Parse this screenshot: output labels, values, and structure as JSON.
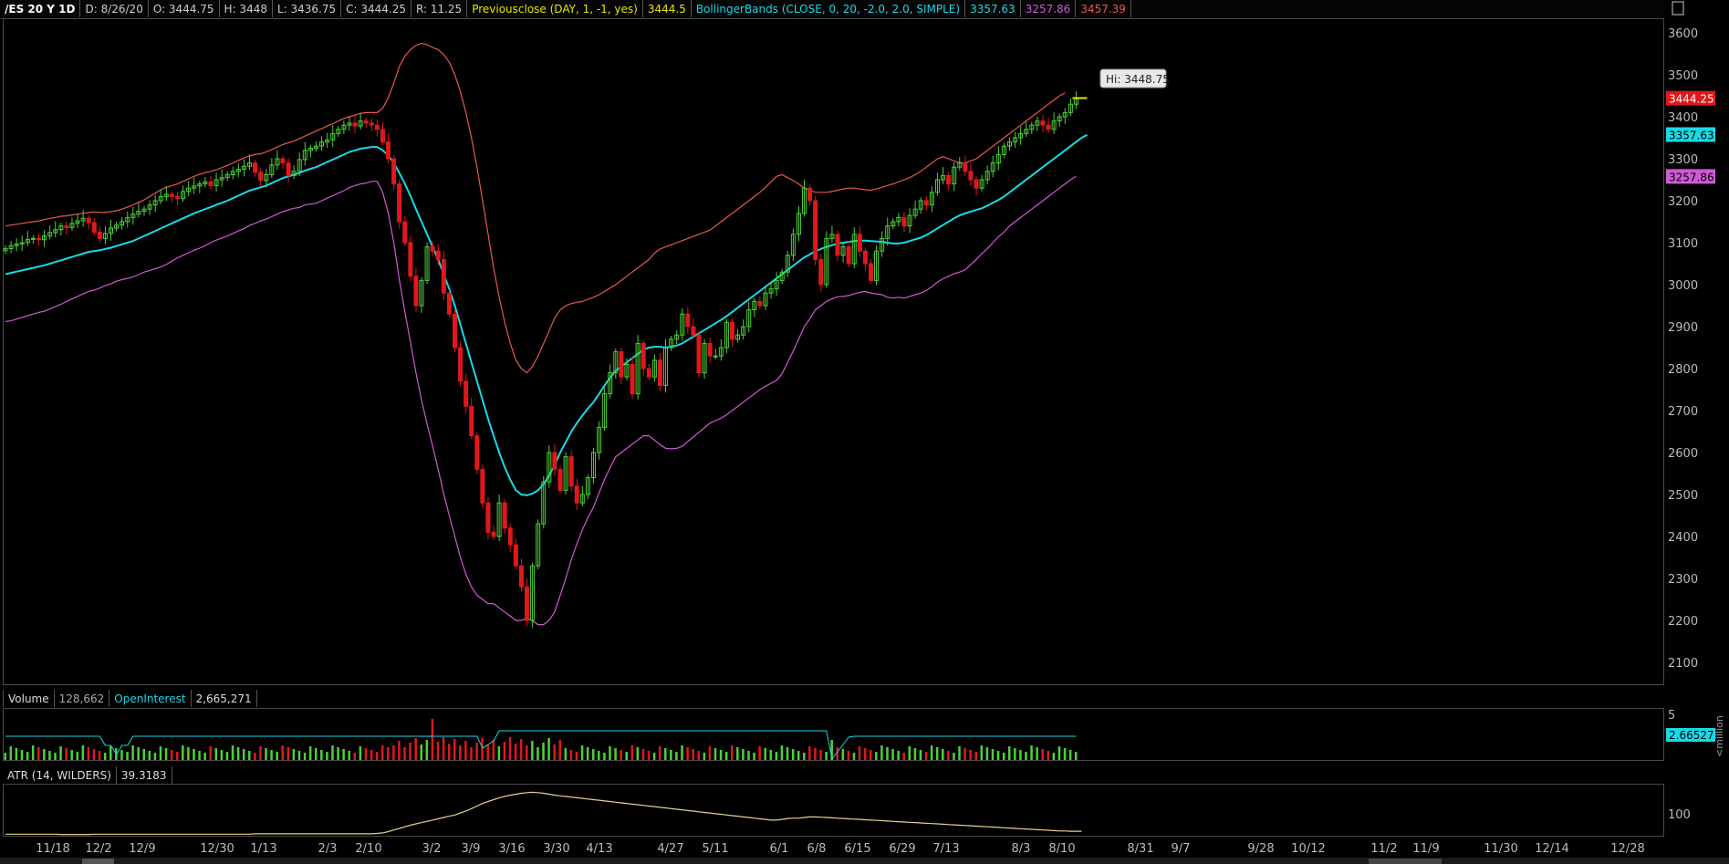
{
  "header": {
    "symbol": "/ES 20 Y 1D",
    "date": "D: 8/26/20",
    "open": "O: 3444.75",
    "high": "H: 3448",
    "low": "L: 3436.75",
    "close": "C: 3444.25",
    "range": "R: 11.25",
    "prev_close_label": "Previousclose (DAY, 1, -1, yes)",
    "prev_close_value": "3444.5",
    "bb_label": "BollingerBands (CLOSE, 0, 20, -2.0, 2.0, SIMPLE)",
    "bb_mid": "3357.63",
    "bb_lower": "3257.86",
    "bb_upper": "3457.39"
  },
  "volume_header": {
    "label": "Volume",
    "value": "128,662",
    "oi_label": "OpenInterest",
    "oi_value": "2,665,271"
  },
  "atr_header": {
    "label": "ATR (14, WILDERS)",
    "value": "39.3183"
  },
  "tooltip": "Hi: 3448.75",
  "right_tags": {
    "close": "3444.25",
    "mid": "3357.63",
    "lower": "3257.86",
    "oi": "2.66527",
    "vol_unit": "<million",
    "vol_tick": "5",
    "atr_tick": "100"
  },
  "colors": {
    "up": "#4cd137",
    "down": "#e0181b",
    "bb_upper": "#e8584e",
    "bb_mid": "#19d9e6",
    "bb_lower": "#d05ad6",
    "atr": "#e8cf8f",
    "oi": "#19d9e6",
    "prev_close": "#e6e600"
  },
  "chart_data": {
    "type": "line",
    "y_ticks": [
      2100,
      2200,
      2300,
      2400,
      2500,
      2600,
      2700,
      2800,
      2900,
      3000,
      3100,
      3200,
      3300,
      3400,
      3500,
      3600
    ],
    "ylim": [
      2060,
      3620
    ],
    "x_ticks": [
      "11/18",
      "12/2",
      "12/9",
      "12/30",
      "1/13",
      "2/3",
      "2/10",
      "3/2",
      "3/9",
      "3/16",
      "3/30",
      "4/13",
      "4/27",
      "5/11",
      "6/1",
      "6/8",
      "6/15",
      "6/29",
      "7/13",
      "8/3",
      "8/10",
      "8/31",
      "9/7",
      "9/28",
      "10/12",
      "11/2",
      "11/9",
      "11/30",
      "12/14",
      "12/28"
    ],
    "close": [
      3086,
      3093,
      3097,
      3100,
      3108,
      3110,
      3107,
      3116,
      3124,
      3131,
      3140,
      3136,
      3146,
      3152,
      3158,
      3148,
      3125,
      3110,
      3122,
      3135,
      3142,
      3150,
      3160,
      3168,
      3175,
      3180,
      3190,
      3200,
      3210,
      3215,
      3210,
      3205,
      3222,
      3230,
      3235,
      3240,
      3245,
      3236,
      3250,
      3255,
      3262,
      3270,
      3275,
      3282,
      3290,
      3268,
      3248,
      3262,
      3285,
      3300,
      3290,
      3260,
      3270,
      3298,
      3320,
      3325,
      3330,
      3340,
      3345,
      3360,
      3370,
      3380,
      3385,
      3378,
      3390,
      3385,
      3380,
      3370,
      3340,
      3300,
      3240,
      3150,
      3100,
      3020,
      2950,
      3010,
      3090,
      3080,
      3060,
      2980,
      2930,
      2850,
      2770,
      2710,
      2640,
      2560,
      2480,
      2410,
      2400,
      2480,
      2420,
      2380,
      2330,
      2280,
      2200,
      2330,
      2430,
      2530,
      2600,
      2560,
      2510,
      2590,
      2520,
      2480,
      2500,
      2540,
      2600,
      2660,
      2740,
      2790,
      2840,
      2780,
      2810,
      2740,
      2860,
      2800,
      2780,
      2820,
      2760,
      2850,
      2870,
      2880,
      2930,
      2900,
      2880,
      2790,
      2860,
      2830,
      2830,
      2850,
      2910,
      2870,
      2880,
      2900,
      2940,
      2960,
      2950,
      2980,
      2990,
      3010,
      3030,
      3070,
      3120,
      3170,
      3230,
      3200,
      3060,
      3000,
      3110,
      3120,
      3070,
      3090,
      3050,
      3120,
      3080,
      3050,
      3010,
      3080,
      3110,
      3140,
      3150,
      3160,
      3140,
      3165,
      3180,
      3200,
      3190,
      3220,
      3250,
      3260,
      3240,
      3280,
      3290,
      3270,
      3250,
      3230,
      3250,
      3270,
      3290,
      3310,
      3330,
      3340,
      3350,
      3360,
      3370,
      3380,
      3390,
      3380,
      3370,
      3390,
      3400,
      3410,
      3430,
      3444
    ],
    "bb_upper": [
      3140,
      3142,
      3144,
      3146,
      3148,
      3150,
      3152,
      3155,
      3158,
      3160,
      3163,
      3164,
      3166,
      3168,
      3170,
      3172,
      3173,
      3172,
      3172,
      3174,
      3176,
      3180,
      3185,
      3190,
      3196,
      3202,
      3210,
      3218,
      3226,
      3232,
      3236,
      3240,
      3246,
      3252,
      3258,
      3263,
      3267,
      3270,
      3274,
      3279,
      3284,
      3290,
      3296,
      3302,
      3307,
      3310,
      3312,
      3316,
      3322,
      3328,
      3334,
      3338,
      3342,
      3348,
      3354,
      3360,
      3366,
      3372,
      3378,
      3384,
      3390,
      3396,
      3400,
      3404,
      3408,
      3410,
      3410,
      3410,
      3420,
      3445,
      3480,
      3520,
      3545,
      3560,
      3570,
      3575,
      3572,
      3565,
      3560,
      3548,
      3530,
      3500,
      3460,
      3410,
      3350,
      3280,
      3200,
      3120,
      3040,
      2970,
      2910,
      2860,
      2820,
      2800,
      2790,
      2805,
      2830,
      2860,
      2890,
      2920,
      2940,
      2950,
      2955,
      2958,
      2960,
      2965,
      2970,
      2976,
      2984,
      2992,
      3000,
      3010,
      3020,
      3030,
      3040,
      3050,
      3060,
      3075,
      3085,
      3090,
      3095,
      3100,
      3105,
      3110,
      3115,
      3120,
      3125,
      3130,
      3140,
      3150,
      3160,
      3170,
      3180,
      3190,
      3200,
      3210,
      3220,
      3232,
      3245,
      3258,
      3262,
      3255,
      3248,
      3240,
      3230,
      3225,
      3220,
      3220,
      3220,
      3222,
      3225,
      3228,
      3230,
      3230,
      3228,
      3226,
      3225,
      3228,
      3232,
      3236,
      3240,
      3245,
      3250,
      3255,
      3262,
      3270,
      3280,
      3290,
      3300,
      3305,
      3300,
      3295,
      3290,
      3290,
      3295,
      3300,
      3310,
      3320,
      3330,
      3340,
      3350,
      3360,
      3370,
      3380,
      3390,
      3400,
      3410,
      3420,
      3430,
      3440,
      3450,
      3457
    ],
    "bb_mid": [
      3025,
      3028,
      3031,
      3034,
      3037,
      3040,
      3043,
      3046,
      3050,
      3054,
      3058,
      3062,
      3066,
      3070,
      3074,
      3078,
      3080,
      3082,
      3085,
      3088,
      3092,
      3096,
      3100,
      3104,
      3110,
      3116,
      3122,
      3128,
      3134,
      3140,
      3146,
      3152,
      3158,
      3164,
      3170,
      3175,
      3180,
      3185,
      3190,
      3195,
      3200,
      3206,
      3212,
      3218,
      3224,
      3228,
      3232,
      3236,
      3242,
      3248,
      3254,
      3258,
      3262,
      3266,
      3272,
      3276,
      3280,
      3286,
      3292,
      3298,
      3304,
      3310,
      3316,
      3320,
      3324,
      3326,
      3328,
      3328,
      3320,
      3308,
      3290,
      3266,
      3240,
      3212,
      3180,
      3150,
      3120,
      3090,
      3060,
      3025,
      2990,
      2950,
      2905,
      2860,
      2815,
      2770,
      2725,
      2680,
      2640,
      2600,
      2565,
      2535,
      2510,
      2500,
      2498,
      2502,
      2510,
      2525,
      2545,
      2570,
      2600,
      2625,
      2650,
      2670,
      2688,
      2705,
      2720,
      2740,
      2760,
      2778,
      2795,
      2805,
      2815,
      2825,
      2835,
      2845,
      2850,
      2852,
      2852,
      2850,
      2852,
      2855,
      2860,
      2868,
      2876,
      2884,
      2892,
      2900,
      2908,
      2916,
      2925,
      2935,
      2945,
      2955,
      2965,
      2975,
      2985,
      2995,
      3005,
      3015,
      3025,
      3035,
      3045,
      3055,
      3065,
      3072,
      3080,
      3085,
      3090,
      3094,
      3098,
      3100,
      3102,
      3104,
      3105,
      3105,
      3104,
      3103,
      3102,
      3100,
      3098,
      3098,
      3100,
      3104,
      3108,
      3112,
      3118,
      3126,
      3134,
      3142,
      3150,
      3158,
      3165,
      3170,
      3174,
      3178,
      3182,
      3188,
      3195,
      3202,
      3210,
      3220,
      3230,
      3240,
      3250,
      3260,
      3270,
      3280,
      3290,
      3300,
      3310,
      3320,
      3330,
      3340,
      3350,
      3357
    ],
    "bb_lower": [
      2912,
      2914,
      2918,
      2922,
      2926,
      2930,
      2934,
      2937,
      2942,
      2948,
      2953,
      2960,
      2966,
      2972,
      2978,
      2984,
      2987,
      2992,
      2998,
      3002,
      3008,
      3012,
      3015,
      3018,
      3024,
      3030,
      3034,
      3038,
      3042,
      3048,
      3056,
      3064,
      3070,
      3076,
      3082,
      3087,
      3093,
      3100,
      3106,
      3111,
      3116,
      3122,
      3128,
      3134,
      3141,
      3146,
      3152,
      3156,
      3162,
      3168,
      3174,
      3178,
      3182,
      3184,
      3190,
      3192,
      3194,
      3200,
      3206,
      3212,
      3218,
      3224,
      3232,
      3236,
      3240,
      3242,
      3246,
      3246,
      3220,
      3171,
      3100,
      3012,
      2935,
      2864,
      2790,
      2725,
      2668,
      2615,
      2560,
      2502,
      2450,
      2400,
      2350,
      2310,
      2280,
      2260,
      2250,
      2240,
      2240,
      2230,
      2220,
      2210,
      2200,
      2200,
      2206,
      2199,
      2190,
      2190,
      2200,
      2220,
      2260,
      2300,
      2345,
      2382,
      2416,
      2445,
      2470,
      2504,
      2536,
      2564,
      2590,
      2600,
      2610,
      2620,
      2630,
      2640,
      2640,
      2629,
      2619,
      2610,
      2609,
      2610,
      2615,
      2626,
      2637,
      2648,
      2659,
      2670,
      2676,
      2682,
      2690,
      2700,
      2710,
      2720,
      2730,
      2740,
      2750,
      2758,
      2765,
      2772,
      2788,
      2815,
      2842,
      2870,
      2900,
      2919,
      2940,
      2950,
      2960,
      2966,
      2971,
      2972,
      2974,
      2978,
      2982,
      2984,
      2980,
      2978,
      2976,
      2970,
      2968,
      2970,
      2968,
      2972,
      2976,
      2980,
      2986,
      2995,
      3006,
      3014,
      3020,
      3026,
      3030,
      3035,
      3048,
      3060,
      3074,
      3086,
      3100,
      3114,
      3125,
      3140,
      3150,
      3160,
      3170,
      3180,
      3190,
      3200,
      3210,
      3220,
      3230,
      3240,
      3250,
      3258
    ],
    "atr": [
      30,
      30,
      30,
      30,
      30,
      30,
      30,
      30,
      30,
      30,
      29,
      29,
      29,
      29,
      29,
      29,
      30,
      30,
      30,
      30,
      30,
      30,
      30,
      30,
      30,
      30,
      30,
      30,
      30,
      30,
      30,
      30,
      30,
      30,
      30,
      30,
      30,
      30,
      30,
      30,
      30,
      30,
      30,
      30,
      30,
      31,
      31,
      31,
      31,
      31,
      31,
      31,
      31,
      31,
      31,
      31,
      31,
      31,
      31,
      31,
      31,
      31,
      31,
      31,
      31,
      31,
      31,
      32,
      34,
      38,
      43,
      48,
      53,
      58,
      62,
      66,
      70,
      74,
      78,
      82,
      86,
      90,
      96,
      102,
      110,
      118,
      126,
      132,
      138,
      144,
      148,
      152,
      155,
      158,
      160,
      161,
      160,
      158,
      155,
      152,
      150,
      148,
      146,
      144,
      142,
      140,
      138,
      136,
      134,
      132,
      130,
      128,
      126,
      124,
      122,
      120,
      118,
      116,
      114,
      112,
      110,
      108,
      106,
      104,
      102,
      100,
      98,
      96,
      94,
      92,
      90,
      88,
      86,
      84,
      82,
      80,
      78,
      76,
      74,
      74,
      76,
      79,
      80,
      80,
      82,
      84,
      84,
      83,
      82,
      81,
      80,
      79,
      78,
      77,
      76,
      75,
      74,
      73,
      72,
      71,
      70,
      69,
      68,
      67,
      66,
      65,
      64,
      63,
      62,
      61,
      60,
      59,
      58,
      57,
      56,
      55,
      54,
      53,
      52,
      51,
      50,
      49,
      48,
      47,
      46,
      45,
      44,
      43,
      42,
      41,
      40,
      40,
      39,
      39,
      39
    ]
  }
}
